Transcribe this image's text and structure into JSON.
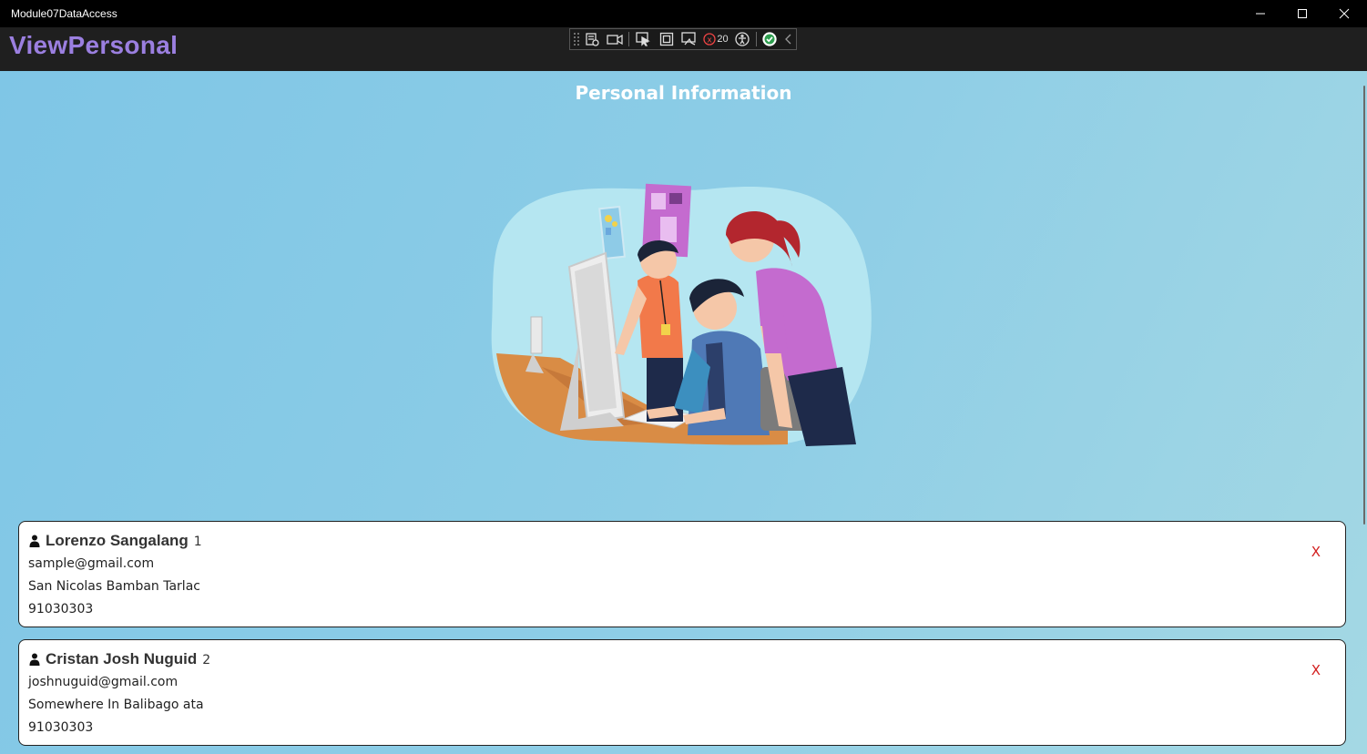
{
  "window": {
    "title": "Module07DataAccess"
  },
  "navbar": {
    "title": "ViewPersonal",
    "title_color": "#9b7fe0"
  },
  "debug_toolbar": {
    "binding_failures_count": "20"
  },
  "page": {
    "heading": "Personal Information"
  },
  "people": [
    {
      "name": "Lorenzo Sangalang",
      "id": "1",
      "email": "sample@gmail.com",
      "address": "San Nicolas Bamban Tarlac",
      "phone": "91030303",
      "delete_label": "X"
    },
    {
      "name": "Cristan Josh Nuguid",
      "id": "2",
      "email": "joshnuguid@gmail.com",
      "address": "Somewhere In Balibago ata",
      "phone": "91030303",
      "delete_label": "X"
    }
  ],
  "colors": {
    "delete": "#d32020",
    "background_start": "#7fc6e6",
    "background_end": "#a4d8e4"
  }
}
